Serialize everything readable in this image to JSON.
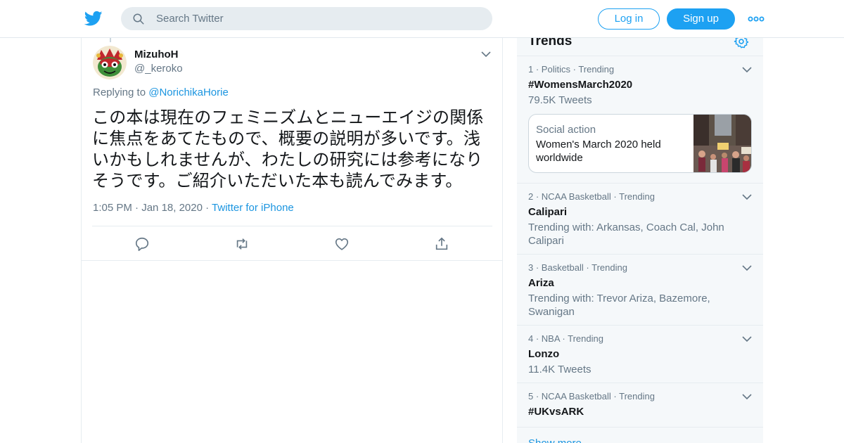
{
  "header": {
    "search_placeholder": "Search Twitter",
    "login_label": "Log in",
    "signup_label": "Sign up"
  },
  "tweet": {
    "name": "MizuhoH",
    "handle": "@_keroko",
    "replying_prefix": "Replying to",
    "replying_to": "@NorichikaHorie",
    "text": "この本は現在のフェミニズムとニューエイジの関係に焦点をあてたもので、概要の説明が多いです。浅いかもしれませんが、わたしの研究には参考になりそうです。ご紹介いただいた本も読んでみます。",
    "time": "1:05 PM",
    "date": "Jan 18, 2020",
    "source": "Twitter for iPhone"
  },
  "trends": {
    "title": "Trends",
    "items": [
      {
        "rank": "1",
        "category": "Politics",
        "status": "Trending",
        "name": "#WomensMarch2020",
        "sub": "79.5K Tweets"
      },
      {
        "rank": "2",
        "category": "NCAA Basketball",
        "status": "Trending",
        "name": "Calipari",
        "sub": "Trending with: Arkansas, Coach Cal, John Calipari"
      },
      {
        "rank": "3",
        "category": "Basketball",
        "status": "Trending",
        "name": "Ariza",
        "sub": "Trending with: Trevor Ariza, Bazemore, Swanigan"
      },
      {
        "rank": "4",
        "category": "NBA",
        "status": "Trending",
        "name": "Lonzo",
        "sub": "11.4K Tweets"
      },
      {
        "rank": "5",
        "category": "NCAA Basketball",
        "status": "Trending",
        "name": "#UKvsARK",
        "sub": ""
      }
    ],
    "card": {
      "label": "Social action",
      "title": "Women's March 2020 held worldwide"
    },
    "show_more": "Show more"
  },
  "colors": {
    "accent": "#1da1f2",
    "link": "#1b95e0",
    "muted": "#657786",
    "panel": "#f5f8fa"
  }
}
